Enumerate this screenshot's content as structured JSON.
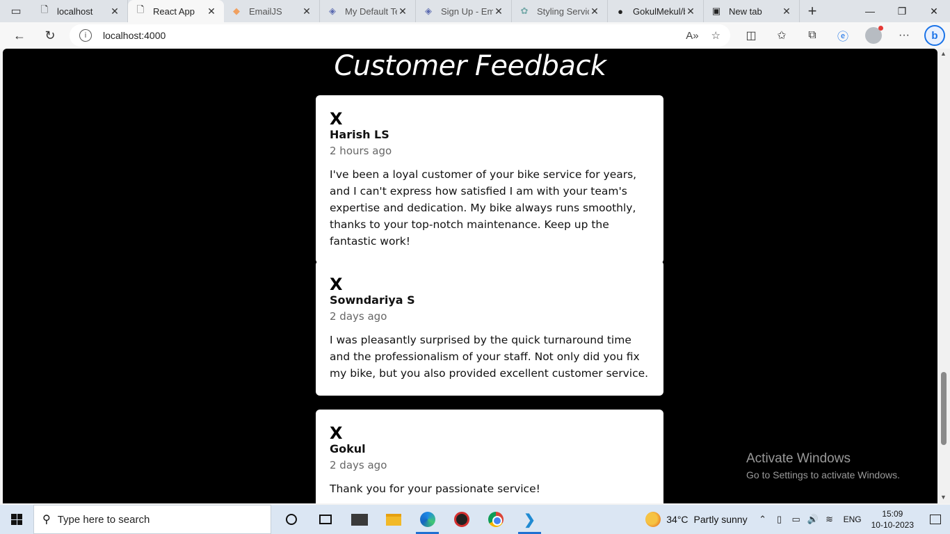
{
  "browser": {
    "tabs": [
      {
        "title": "localhost",
        "icon": "page-icon"
      },
      {
        "title": "React App",
        "icon": "page-icon",
        "active": true
      },
      {
        "title": "EmailJS",
        "icon": "emailjs-icon"
      },
      {
        "title": "My Default Te",
        "icon": "shield-icon"
      },
      {
        "title": "Sign Up - Ema",
        "icon": "shield-icon"
      },
      {
        "title": "Styling Service",
        "icon": "openai-icon"
      },
      {
        "title": "GokulMekul/b",
        "icon": "github-icon"
      },
      {
        "title": "New tab",
        "icon": "newtab-icon"
      }
    ],
    "url": "localhost:4000"
  },
  "page": {
    "title": "Customer Feedback",
    "feedback": [
      {
        "icon": "x-icon",
        "author": "Harish LS",
        "time": "2 hours ago",
        "text": "I've been a loyal customer of your bike service for years, and I can't express how satisfied I am with your team's expertise and dedication. My bike always runs smoothly, thanks to your top-notch maintenance. Keep up the fantastic work!"
      },
      {
        "icon": "x-icon",
        "author": "Sowndariya S",
        "time": "2 days ago",
        "text": "I was pleasantly surprised by the quick turnaround time and the professionalism of your staff. Not only did you fix my bike, but you also provided excellent customer service."
      },
      {
        "icon": "x-icon",
        "author": "Gokul",
        "time": "2 days ago",
        "text": "Thank you for your passionate service!"
      }
    ]
  },
  "watermark": {
    "line1": "Activate Windows",
    "line2": "Go to Settings to activate Windows."
  },
  "taskbar": {
    "search_placeholder": "Type here to search",
    "weather_temp": "34°C",
    "weather_text": "Partly sunny",
    "language": "ENG",
    "time": "15:09",
    "date": "10-10-2023"
  },
  "colors": {
    "page_background": "#000000",
    "card_background": "#ffffff",
    "accent": "#1f6fd1"
  }
}
